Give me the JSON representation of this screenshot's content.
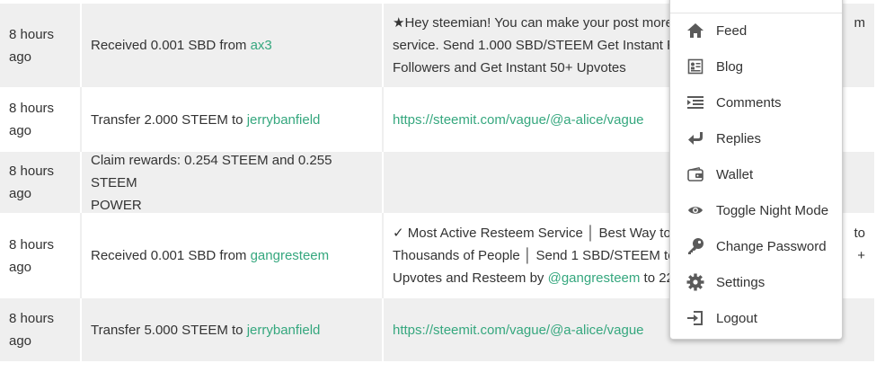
{
  "transfers": {
    "rows": [
      {
        "time_line1": "8 hours",
        "time_line2": "ago",
        "op_prefix": "Received 0.001 SBD from ",
        "op_link": "ax3",
        "memo_line1": "★Hey steemian! You can make your post more",
        "memo_line1_tail": "m",
        "memo_line2": "service. Send 1.000 SBD/STEEM Get Instant Res",
        "memo_line3": "Followers and Get Instant 50+ Upvotes"
      },
      {
        "time_line1": "8 hours",
        "time_line2": "ago",
        "op_prefix": "Transfer 2.000 STEEM to ",
        "op_link": "jerrybanfield",
        "memo_link": "https://steemit.com/vague/@a-alice/vague"
      },
      {
        "time_line1": "8 hours",
        "time_line2": "ago",
        "op_line1": "Claim rewards: 0.254 STEEM and 0.255 STEEM",
        "op_line2": "POWER"
      },
      {
        "time_line1": "8 hours",
        "time_line2": "ago",
        "op_prefix": "Received 0.001 SBD from ",
        "op_link": "gangresteem",
        "memo_line1": "✓ Most Active Resteem Service │ Best Way to P",
        "memo_line1_tail": "to",
        "memo_line2": "Thousands of People │ Send 1 SBD/STEEM to ",
        "memo_line2_link": "@",
        "memo_line2_tail": "+",
        "memo_line3_prefix": "Upvotes and Resteem by ",
        "memo_line3_link": "@gangresteem",
        "memo_line3_suffix": " to 22,"
      },
      {
        "time_line1": "8 hours",
        "time_line2": "ago",
        "op_prefix": "Transfer 5.000 STEEM to ",
        "op_link": "jerrybanfield",
        "memo_link": "https://steemit.com/vague/@a-alice/vague"
      }
    ]
  },
  "user_menu": {
    "items": [
      {
        "label": "Feed",
        "icon": "home-icon"
      },
      {
        "label": "Blog",
        "icon": "blog-icon"
      },
      {
        "label": "Comments",
        "icon": "comments-icon"
      },
      {
        "label": "Replies",
        "icon": "reply-icon"
      },
      {
        "label": "Wallet",
        "icon": "wallet-icon"
      },
      {
        "label": "Toggle Night Mode",
        "icon": "eye-icon"
      },
      {
        "label": "Change Password",
        "icon": "key-icon"
      },
      {
        "label": "Settings",
        "icon": "gear-icon"
      },
      {
        "label": "Logout",
        "icon": "logout-icon"
      }
    ]
  },
  "colors": {
    "link": "#35a77e",
    "row_shade": "#efefef",
    "icon": "#5a5a5a"
  }
}
